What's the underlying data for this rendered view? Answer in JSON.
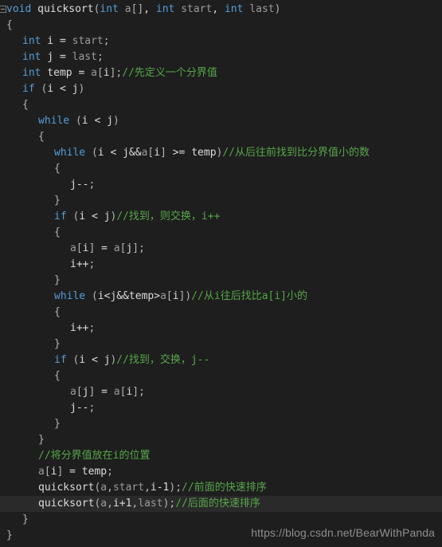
{
  "editor": {
    "theme_background": "#1e1e1e",
    "current_line_background": "#2a2a2a",
    "colors": {
      "keyword": "#569cd6",
      "identifier": "#9b9b9b",
      "plain": "#dcdcdc",
      "comment": "#57a64a",
      "brace": "#b4b4b4"
    },
    "fold_icon": "collapse-minus-box",
    "current_line_index": 28
  },
  "watermark": {
    "text": "https://blog.csdn.net/BearWithPanda"
  },
  "code": {
    "language": "cpp",
    "lines": [
      {
        "indent": 0,
        "current": false,
        "fold": true,
        "tokens": [
          {
            "t": "kw",
            "s": "void"
          },
          {
            "t": "pl",
            "s": " "
          },
          {
            "t": "pl",
            "s": "quicksort"
          },
          {
            "t": "brc",
            "s": "("
          },
          {
            "t": "kw",
            "s": "int"
          },
          {
            "t": "pl",
            "s": " "
          },
          {
            "t": "id",
            "s": "a"
          },
          {
            "t": "brc",
            "s": "[]"
          },
          {
            "t": "pl",
            "s": ", "
          },
          {
            "t": "kw",
            "s": "int"
          },
          {
            "t": "pl",
            "s": " "
          },
          {
            "t": "id",
            "s": "start"
          },
          {
            "t": "pl",
            "s": ", "
          },
          {
            "t": "kw",
            "s": "int"
          },
          {
            "t": "pl",
            "s": " "
          },
          {
            "t": "id",
            "s": "last"
          },
          {
            "t": "brc",
            "s": ")"
          }
        ]
      },
      {
        "indent": 0,
        "current": false,
        "tokens": [
          {
            "t": "brc",
            "s": "{"
          }
        ]
      },
      {
        "indent": 1,
        "current": false,
        "tokens": [
          {
            "t": "kw",
            "s": "int"
          },
          {
            "t": "pl",
            "s": " i = "
          },
          {
            "t": "id",
            "s": "start"
          },
          {
            "t": "brc",
            "s": ";"
          }
        ]
      },
      {
        "indent": 1,
        "current": false,
        "tokens": [
          {
            "t": "kw",
            "s": "int"
          },
          {
            "t": "pl",
            "s": " j = "
          },
          {
            "t": "id",
            "s": "last"
          },
          {
            "t": "brc",
            "s": ";"
          }
        ]
      },
      {
        "indent": 1,
        "current": false,
        "tokens": [
          {
            "t": "kw",
            "s": "int"
          },
          {
            "t": "pl",
            "s": " temp = "
          },
          {
            "t": "id",
            "s": "a"
          },
          {
            "t": "brc",
            "s": "["
          },
          {
            "t": "pl",
            "s": "i"
          },
          {
            "t": "brc",
            "s": "];"
          },
          {
            "t": "cmt",
            "s": "//先定义一个分界值"
          }
        ]
      },
      {
        "indent": 1,
        "current": false,
        "tokens": [
          {
            "t": "kw",
            "s": "if"
          },
          {
            "t": "pl",
            "s": " "
          },
          {
            "t": "brc",
            "s": "("
          },
          {
            "t": "pl",
            "s": "i < j"
          },
          {
            "t": "brc",
            "s": ")"
          }
        ]
      },
      {
        "indent": 1,
        "current": false,
        "tokens": [
          {
            "t": "brc",
            "s": "{"
          }
        ]
      },
      {
        "indent": 2,
        "current": false,
        "tokens": [
          {
            "t": "kw",
            "s": "while"
          },
          {
            "t": "pl",
            "s": " "
          },
          {
            "t": "brc",
            "s": "("
          },
          {
            "t": "pl",
            "s": "i < j"
          },
          {
            "t": "brc",
            "s": ")"
          }
        ]
      },
      {
        "indent": 2,
        "current": false,
        "tokens": [
          {
            "t": "brc",
            "s": "{"
          }
        ]
      },
      {
        "indent": 3,
        "current": false,
        "tokens": [
          {
            "t": "kw",
            "s": "while"
          },
          {
            "t": "pl",
            "s": " "
          },
          {
            "t": "brc",
            "s": "("
          },
          {
            "t": "pl",
            "s": "i < j&&"
          },
          {
            "t": "id",
            "s": "a"
          },
          {
            "t": "brc",
            "s": "["
          },
          {
            "t": "pl",
            "s": "i"
          },
          {
            "t": "brc",
            "s": "]"
          },
          {
            "t": "pl",
            "s": " >= temp"
          },
          {
            "t": "brc",
            "s": ")"
          },
          {
            "t": "cmt",
            "s": "//从后往前找到比分界值小的数"
          }
        ]
      },
      {
        "indent": 3,
        "current": false,
        "tokens": [
          {
            "t": "brc",
            "s": "{"
          }
        ]
      },
      {
        "indent": 4,
        "current": false,
        "tokens": [
          {
            "t": "pl",
            "s": "j--"
          },
          {
            "t": "brc",
            "s": ";"
          }
        ]
      },
      {
        "indent": 3,
        "current": false,
        "tokens": [
          {
            "t": "brc",
            "s": "}"
          }
        ]
      },
      {
        "indent": 3,
        "current": false,
        "tokens": [
          {
            "t": "kw",
            "s": "if"
          },
          {
            "t": "pl",
            "s": " "
          },
          {
            "t": "brc",
            "s": "("
          },
          {
            "t": "pl",
            "s": "i < j"
          },
          {
            "t": "brc",
            "s": ")"
          },
          {
            "t": "cmt",
            "s": "//找到，则交换，i++"
          }
        ]
      },
      {
        "indent": 3,
        "current": false,
        "tokens": [
          {
            "t": "brc",
            "s": "{"
          }
        ]
      },
      {
        "indent": 4,
        "current": false,
        "tokens": [
          {
            "t": "id",
            "s": "a"
          },
          {
            "t": "brc",
            "s": "["
          },
          {
            "t": "pl",
            "s": "i"
          },
          {
            "t": "brc",
            "s": "]"
          },
          {
            "t": "pl",
            "s": " = "
          },
          {
            "t": "id",
            "s": "a"
          },
          {
            "t": "brc",
            "s": "["
          },
          {
            "t": "pl",
            "s": "j"
          },
          {
            "t": "brc",
            "s": "];"
          }
        ]
      },
      {
        "indent": 4,
        "current": false,
        "tokens": [
          {
            "t": "pl",
            "s": "i++"
          },
          {
            "t": "brc",
            "s": ";"
          }
        ]
      },
      {
        "indent": 3,
        "current": false,
        "tokens": [
          {
            "t": "brc",
            "s": "}"
          }
        ]
      },
      {
        "indent": 3,
        "current": false,
        "tokens": [
          {
            "t": "kw",
            "s": "while"
          },
          {
            "t": "pl",
            "s": " "
          },
          {
            "t": "brc",
            "s": "("
          },
          {
            "t": "pl",
            "s": "i<j&&temp>"
          },
          {
            "t": "id",
            "s": "a"
          },
          {
            "t": "brc",
            "s": "["
          },
          {
            "t": "pl",
            "s": "i"
          },
          {
            "t": "brc",
            "s": "])"
          },
          {
            "t": "cmt",
            "s": "//从i往后找比a[i]小的"
          }
        ]
      },
      {
        "indent": 3,
        "current": false,
        "tokens": [
          {
            "t": "brc",
            "s": "{"
          }
        ]
      },
      {
        "indent": 4,
        "current": false,
        "tokens": [
          {
            "t": "pl",
            "s": "i++"
          },
          {
            "t": "brc",
            "s": ";"
          }
        ]
      },
      {
        "indent": 3,
        "current": false,
        "tokens": [
          {
            "t": "brc",
            "s": "}"
          }
        ]
      },
      {
        "indent": 3,
        "current": false,
        "tokens": [
          {
            "t": "kw",
            "s": "if"
          },
          {
            "t": "pl",
            "s": " "
          },
          {
            "t": "brc",
            "s": "("
          },
          {
            "t": "pl",
            "s": "i < j"
          },
          {
            "t": "brc",
            "s": ")"
          },
          {
            "t": "cmt",
            "s": "//找到，交换，j--"
          }
        ]
      },
      {
        "indent": 3,
        "current": false,
        "tokens": [
          {
            "t": "brc",
            "s": "{"
          }
        ]
      },
      {
        "indent": 4,
        "current": false,
        "tokens": [
          {
            "t": "id",
            "s": "a"
          },
          {
            "t": "brc",
            "s": "["
          },
          {
            "t": "pl",
            "s": "j"
          },
          {
            "t": "brc",
            "s": "]"
          },
          {
            "t": "pl",
            "s": " = "
          },
          {
            "t": "id",
            "s": "a"
          },
          {
            "t": "brc",
            "s": "["
          },
          {
            "t": "pl",
            "s": "i"
          },
          {
            "t": "brc",
            "s": "];"
          }
        ]
      },
      {
        "indent": 4,
        "current": false,
        "tokens": [
          {
            "t": "pl",
            "s": "j--"
          },
          {
            "t": "brc",
            "s": ";"
          }
        ]
      },
      {
        "indent": 3,
        "current": false,
        "tokens": [
          {
            "t": "brc",
            "s": "}"
          }
        ]
      },
      {
        "indent": 2,
        "current": false,
        "tokens": [
          {
            "t": "brc",
            "s": "}"
          }
        ]
      },
      {
        "indent": 2,
        "current": false,
        "tokens": [
          {
            "t": "cmt",
            "s": "//将分界值放在i的位置"
          }
        ]
      },
      {
        "indent": 2,
        "current": false,
        "tokens": [
          {
            "t": "id",
            "s": "a"
          },
          {
            "t": "brc",
            "s": "["
          },
          {
            "t": "pl",
            "s": "i"
          },
          {
            "t": "brc",
            "s": "]"
          },
          {
            "t": "pl",
            "s": " = temp"
          },
          {
            "t": "brc",
            "s": ";"
          }
        ]
      },
      {
        "indent": 2,
        "current": false,
        "tokens": [
          {
            "t": "pl",
            "s": "quicksort"
          },
          {
            "t": "brc",
            "s": "("
          },
          {
            "t": "id",
            "s": "a"
          },
          {
            "t": "brc",
            "s": ","
          },
          {
            "t": "id",
            "s": "start"
          },
          {
            "t": "brc",
            "s": ","
          },
          {
            "t": "pl",
            "s": "i-1"
          },
          {
            "t": "brc",
            "s": ");"
          },
          {
            "t": "cmt",
            "s": "//前面的快速排序"
          }
        ]
      },
      {
        "indent": 2,
        "current": true,
        "tokens": [
          {
            "t": "pl",
            "s": "quicksort"
          },
          {
            "t": "brc",
            "s": "("
          },
          {
            "t": "id",
            "s": "a"
          },
          {
            "t": "brc",
            "s": ","
          },
          {
            "t": "pl",
            "s": "i+1"
          },
          {
            "t": "brc",
            "s": ","
          },
          {
            "t": "id",
            "s": "last"
          },
          {
            "t": "brc",
            "s": ");"
          },
          {
            "t": "cmt",
            "s": "//后面的快速排序"
          }
        ]
      },
      {
        "indent": 1,
        "current": false,
        "tokens": [
          {
            "t": "brc",
            "s": "}"
          }
        ]
      },
      {
        "indent": 0,
        "current": false,
        "tokens": [
          {
            "t": "brc",
            "s": "}"
          }
        ]
      }
    ]
  }
}
